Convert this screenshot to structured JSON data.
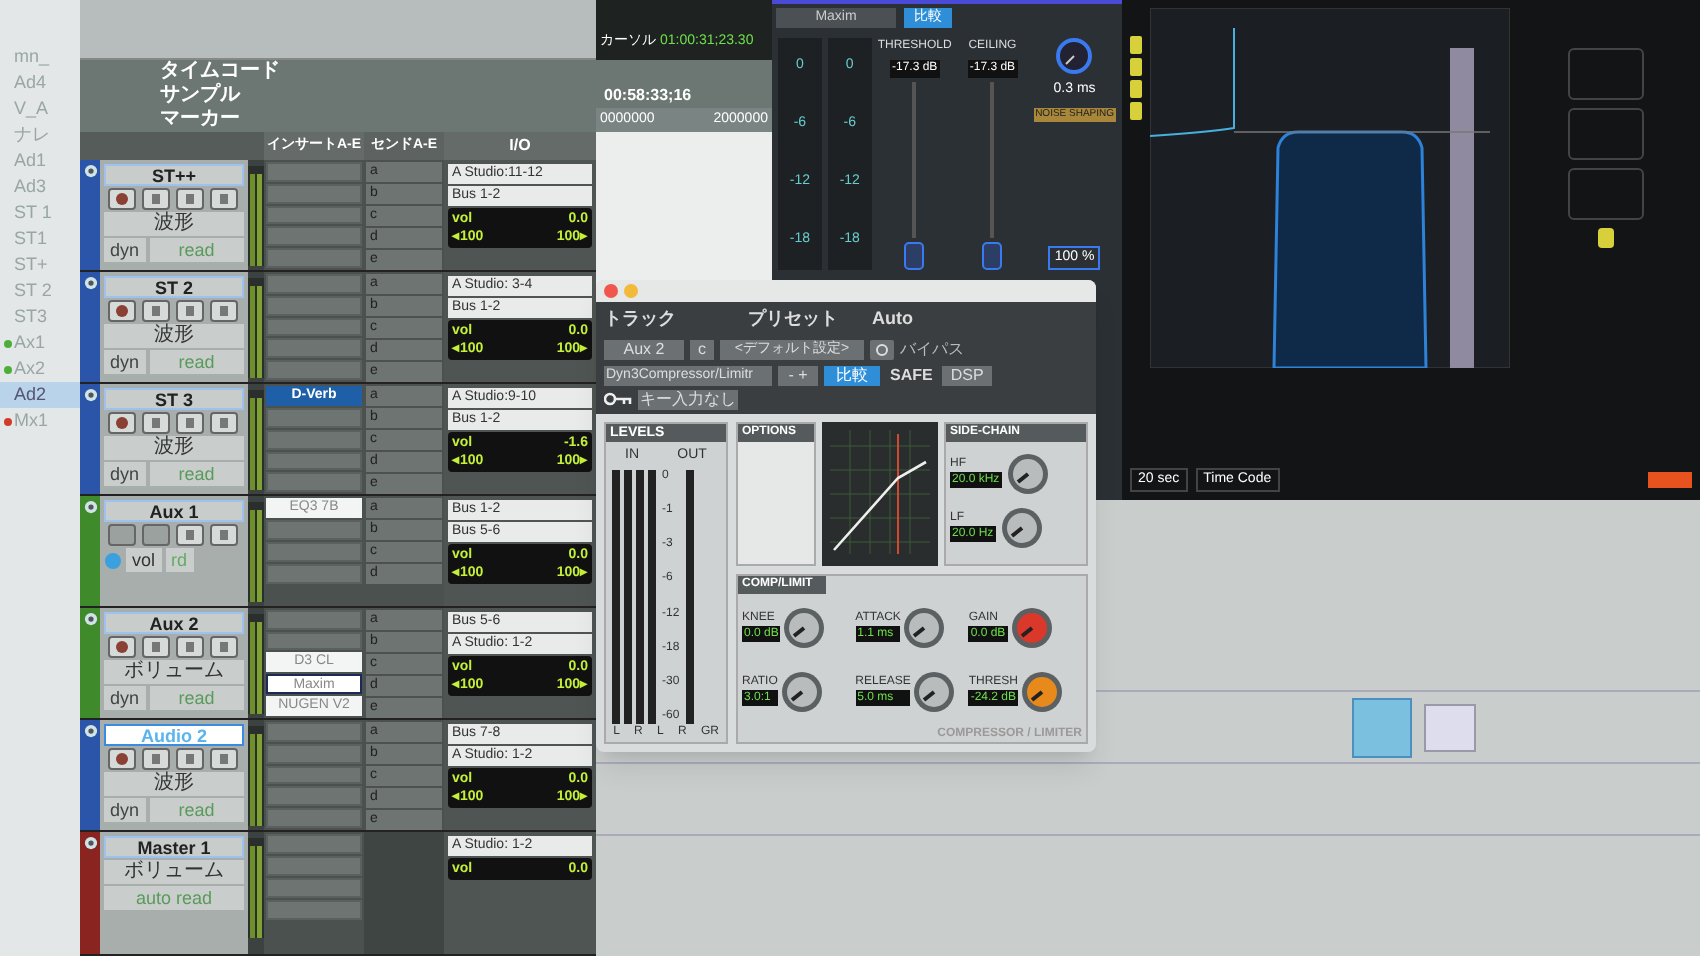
{
  "track_list": {
    "items": [
      {
        "label": "mn_",
        "selected": false
      },
      {
        "label": "Ad4",
        "selected": false
      },
      {
        "label": "V_A",
        "selected": false
      },
      {
        "label": "ナレ",
        "selected": false
      },
      {
        "label": "Ad1",
        "selected": false
      },
      {
        "label": "Ad3",
        "selected": false
      },
      {
        "label": "ST 1",
        "selected": false
      },
      {
        "label": "ST1",
        "selected": false
      },
      {
        "label": "ST+",
        "selected": false
      },
      {
        "label": "ST 2",
        "selected": false
      },
      {
        "label": "ST3",
        "selected": false
      },
      {
        "label": "Ax1",
        "selected": false,
        "color": "#4caf3a"
      },
      {
        "label": "Ax2",
        "selected": false,
        "color": "#4caf3a"
      },
      {
        "label": "Ad2",
        "selected": true
      },
      {
        "label": "Mx1",
        "selected": false,
        "color": "#d23a2a"
      }
    ]
  },
  "edit_window": {
    "counter": {
      "label": "カーソル",
      "value": "01:00:31;23.30"
    },
    "rulers": [
      "タイムコード",
      "サンプル",
      "マーカー"
    ],
    "ruler_values": [
      "00:58:33;16",
      "0000000",
      "2000000"
    ],
    "columns": [
      "インサートA-E",
      "センドA-E",
      "I/O"
    ],
    "tracks": [
      {
        "name": "ST++",
        "kind": "full",
        "color": "#2a55a8",
        "selected": false,
        "view": "波形",
        "automation": "read",
        "inserts": [
          {
            "kind": "empty"
          },
          {
            "kind": "empty"
          },
          {
            "kind": "empty"
          },
          {
            "kind": "empty"
          },
          {
            "kind": "empty"
          }
        ],
        "sends": [
          "a",
          "b",
          "c",
          "d",
          "e"
        ],
        "dyn": "dyn",
        "vol_label": "vol",
        "io": [
          "A Studio:11-12",
          "Bus 1-2"
        ],
        "vol": "0.0",
        "pan": [
          "◂100",
          "100▸"
        ]
      },
      {
        "name": "ST 2",
        "kind": "full",
        "color": "#2a55a8",
        "selected": false,
        "view": "波形",
        "automation": "read",
        "inserts": [
          {
            "kind": "empty"
          },
          {
            "kind": "empty"
          },
          {
            "kind": "empty"
          },
          {
            "kind": "empty"
          },
          {
            "kind": "empty"
          }
        ],
        "sends": [
          "a",
          "b",
          "c",
          "d",
          "e"
        ],
        "dyn": "dyn",
        "vol_label": "vol",
        "io": [
          "A Studio: 3-4",
          "Bus 1-2"
        ],
        "vol": "0.0",
        "pan": [
          "◂100",
          "100▸"
        ]
      },
      {
        "name": "ST 3",
        "kind": "full",
        "color": "#2a55a8",
        "selected": false,
        "view": "波形",
        "automation": "read",
        "inserts": [
          {
            "kind": "plugin",
            "label": "D-Verb",
            "selected": true
          },
          {
            "kind": "empty"
          },
          {
            "kind": "empty"
          },
          {
            "kind": "empty"
          },
          {
            "kind": "empty"
          }
        ],
        "sends": [
          "a",
          "b",
          "c",
          "d",
          "e"
        ],
        "dyn": "dyn",
        "vol_label": "vol",
        "io": [
          "A Studio:9-10",
          "Bus 1-2"
        ],
        "vol": "-1.6",
        "pan": [
          "◂100",
          "100▸"
        ]
      },
      {
        "name": "Aux 1",
        "kind": "compact",
        "color": "#3f8a2a",
        "selected": false,
        "view": "vol",
        "automation": "rd",
        "inserts": [
          {
            "kind": "plugin",
            "label": "EQ3 7B",
            "selected": false
          },
          {
            "kind": "empty"
          },
          {
            "kind": "empty"
          },
          {
            "kind": "empty"
          }
        ],
        "sends": [
          "a",
          "b",
          "c",
          "d"
        ],
        "vol_label": "vol",
        "io": [
          "Bus 1-2",
          "Bus 5-6"
        ],
        "vol": "0.0",
        "pan": [
          "◂100",
          "100▸"
        ]
      },
      {
        "name": "Aux 2",
        "kind": "full",
        "color": "#3f8a2a",
        "selected": false,
        "view": "ボリューム",
        "automation": "read",
        "inserts": [
          {
            "kind": "empty"
          },
          {
            "kind": "empty"
          },
          {
            "kind": "plugin",
            "label": "D3 CL",
            "selected": false
          },
          {
            "kind": "plugin",
            "label": "Maxim",
            "selected": true
          },
          {
            "kind": "plugin",
            "label": "NUGEN V2",
            "selected": false
          }
        ],
        "sends": [
          "a",
          "b",
          "c",
          "d",
          "e"
        ],
        "dyn": "dyn",
        "vol_label": "vol",
        "io": [
          "Bus 5-6",
          "A Studio: 1-2"
        ],
        "vol": "0.0",
        "pan": [
          "◂100",
          "100▸"
        ]
      },
      {
        "name": "Audio 2",
        "kind": "full",
        "color": "#2a55a8",
        "selected": true,
        "view": "波形",
        "automation": "read",
        "inserts": [
          {
            "kind": "empty"
          },
          {
            "kind": "empty"
          },
          {
            "kind": "empty"
          },
          {
            "kind": "empty"
          },
          {
            "kind": "empty"
          }
        ],
        "sends": [
          "a",
          "b",
          "c",
          "d",
          "e"
        ],
        "dyn": "dyn",
        "vol_label": "vol",
        "io": [
          "Bus 7-8",
          "A Studio: 1-2"
        ],
        "vol": "0.0",
        "pan": [
          "◂100",
          "100▸"
        ]
      },
      {
        "name": "Master 1",
        "kind": "master",
        "color": "#8a2420",
        "selected": false,
        "view": "ボリューム",
        "automation": "auto read",
        "inserts": [
          {
            "kind": "empty"
          },
          {
            "kind": "empty"
          },
          {
            "kind": "empty"
          },
          {
            "kind": "empty"
          }
        ],
        "vol_label": "vol",
        "io": [
          "A Studio: 1-2"
        ],
        "vol": "0.0"
      }
    ]
  },
  "maxim": {
    "preset": "Maxim",
    "compare": "比較",
    "threshold": {
      "label": "THRESHOLD",
      "value": "-17.3 dB"
    },
    "ceiling": {
      "label": "CEILING",
      "value": "-17.3 dB"
    },
    "release": "0.3 ms",
    "noise_shaping": "NOISE SHAPING",
    "mix": "100 %",
    "meters": [
      {
        "scale": [
          "0",
          "-6",
          "-12",
          "-18"
        ]
      },
      {
        "scale": [
          "0",
          "-6",
          "-12",
          "-18"
        ]
      }
    ]
  },
  "analyzer": {
    "footer": [
      "20 sec",
      "Time Code"
    ]
  },
  "plugin": {
    "track_label": "トラック",
    "preset_label": "プリセット",
    "auto_label": "Auto",
    "track": "Aux 2",
    "channel": "c",
    "preset": "<デフォルト設定>",
    "bypass": "バイパス",
    "insert": "Dyn3Compressor/Limitr",
    "pm": "- +",
    "compare": "比較",
    "safe": "SAFE",
    "dsp": "DSP",
    "key": "キー入力なし",
    "levels": {
      "title": "LEVELS",
      "in": "IN",
      "out": "OUT",
      "scale": [
        "0",
        "-1",
        "-3",
        "-6",
        "-12",
        "-18",
        "-30",
        "-60"
      ],
      "channels": [
        "L",
        "R",
        "L",
        "R",
        "GR"
      ]
    },
    "options": "OPTIONS",
    "side_chain": {
      "title": "SIDE-CHAIN",
      "filters": [
        {
          "label": "HF",
          "value": "20.0 kHz"
        },
        {
          "label": "LF",
          "value": "20.0 Hz"
        }
      ]
    },
    "comp": {
      "title": "COMP/LIMIT",
      "params": [
        {
          "label": "KNEE",
          "value": "0.0 dB",
          "color": "#b8bcbd"
        },
        {
          "label": "ATTACK",
          "value": "1.1 ms",
          "color": "#b8bcbd"
        },
        {
          "label": "GAIN",
          "value": "0.0 dB",
          "color": "#d9382b"
        },
        {
          "label": "RATIO",
          "value": "3.0:1",
          "color": "#b8bcbd"
        },
        {
          "label": "RELEASE",
          "value": "5.0 ms",
          "color": "#b8bcbd"
        },
        {
          "label": "THRESH",
          "value": "-24.2 dB",
          "color": "#e8891c"
        }
      ]
    },
    "footer": "COMPRESSOR / LIMITER"
  }
}
